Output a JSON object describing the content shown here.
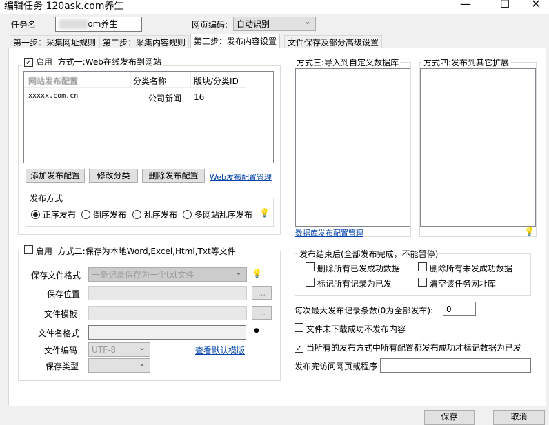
{
  "window": {
    "title": "编辑任务 120ask.com养生",
    "minimize": "—",
    "maximize": "☐",
    "close": "✕"
  },
  "task": {
    "name_label": "任务名",
    "name_value": "om养生",
    "encoding_label": "网页编码:",
    "encoding_value": "自动识别"
  },
  "tabs": [
    {
      "label": "第一步：采集网址规则"
    },
    {
      "label": "第二步：采集内容规则"
    },
    {
      "label": "第三步：发布内容设置"
    },
    {
      "label": "文件保存及部分高级设置"
    }
  ],
  "method1": {
    "enable_label": "启用",
    "title": "方式一:Web在线发布到网站",
    "enabled": true,
    "columns": [
      "网站发布配置",
      "分类名称",
      "版块/分类ID"
    ],
    "rows": [
      [
        "xxxxx.com.cn",
        "公司新闻",
        "16"
      ]
    ],
    "buttons": {
      "add": "添加发布配置",
      "edit": "修改分类",
      "delete": "删除发布配置"
    },
    "manage_link": "Web发布配置管理",
    "publish_mode": {
      "title": "发布方式",
      "options": [
        "正序发布",
        "倒序发布",
        "乱序发布",
        "多网站乱序发布"
      ],
      "selected": "正序发布"
    }
  },
  "method2": {
    "enable_label": "启用",
    "title": "方式二:保存为本地Word,Excel,Html,Txt等文件",
    "enabled": false,
    "format_label": "保存文件格式",
    "format_value": "一条记录保存为一个txt文件",
    "location_label": "保存位置",
    "template_label": "文件模板",
    "filename_label": "文件名格式",
    "encoding_label": "文件编码",
    "encoding_value": "UTF-8",
    "type_label": "保存类型",
    "browse": "...",
    "default_template_link": "查看默认模版"
  },
  "method3": {
    "title": "方式三:导入到自定义数据库",
    "link": "数据库发布配置管理"
  },
  "method4": {
    "title": "方式四:发布到其它扩展"
  },
  "after": {
    "title": "发布结束后(全部发布完成，不能暂停)",
    "options": [
      {
        "label": "删除所有已发成功数据",
        "checked": false
      },
      {
        "label": "删除所有未发成功数据",
        "checked": false
      },
      {
        "label": "标记所有记录为已发",
        "checked": false
      },
      {
        "label": "清空该任务网址库",
        "checked": false
      }
    ]
  },
  "max_records": {
    "label": "每次最大发布记录条数(0为全部发布):",
    "value": "0"
  },
  "no_publish_if_download_fail": {
    "label": "文件未下载成功不发布内容",
    "checked": false
  },
  "mark_when_all_success": {
    "label": "当所有的发布方式中所有配置都发布成功才标记数据为已发",
    "checked": true
  },
  "visit_after": {
    "label": "发布完访问网页或程序",
    "value": ""
  },
  "footer": {
    "save": "保存",
    "cancel": "取消"
  }
}
